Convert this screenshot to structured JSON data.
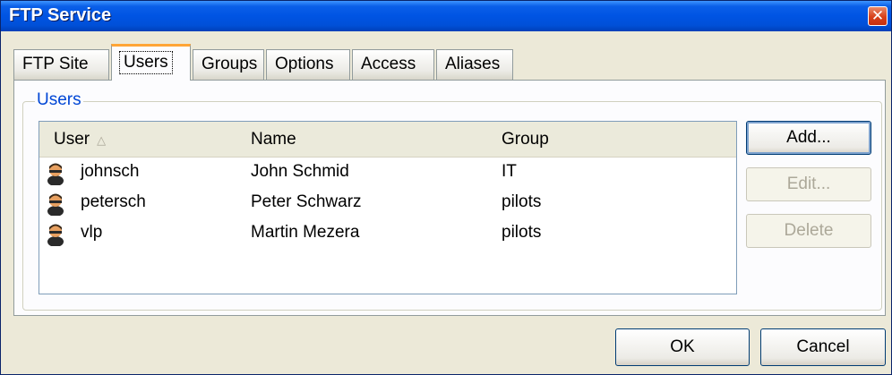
{
  "window": {
    "title": "FTP Service"
  },
  "tabs": [
    {
      "label": "FTP Site",
      "active": false
    },
    {
      "label": "Users",
      "active": true
    },
    {
      "label": "Groups",
      "active": false
    },
    {
      "label": "Options",
      "active": false
    },
    {
      "label": "Access",
      "active": false
    },
    {
      "label": "Aliases",
      "active": false
    }
  ],
  "users_group": {
    "legend": "Users",
    "columns": {
      "user": "User",
      "name": "Name",
      "group": "Group",
      "sort_indicator": "△"
    },
    "rows": [
      {
        "user": "johnsch",
        "name": "John Schmid",
        "group": "IT"
      },
      {
        "user": "petersch",
        "name": "Peter Schwarz",
        "group": "pilots"
      },
      {
        "user": "vlp",
        "name": "Martin Mezera",
        "group": "pilots"
      }
    ],
    "buttons": {
      "add": "Add...",
      "edit": "Edit...",
      "delete": "Delete"
    }
  },
  "footer": {
    "ok": "OK",
    "cancel": "Cancel"
  },
  "colors": {
    "titlebar": "#0054e3",
    "tab_highlight": "#ffa536",
    "legend_text": "#0046d5",
    "dialog_bg": "#ece9d8"
  }
}
